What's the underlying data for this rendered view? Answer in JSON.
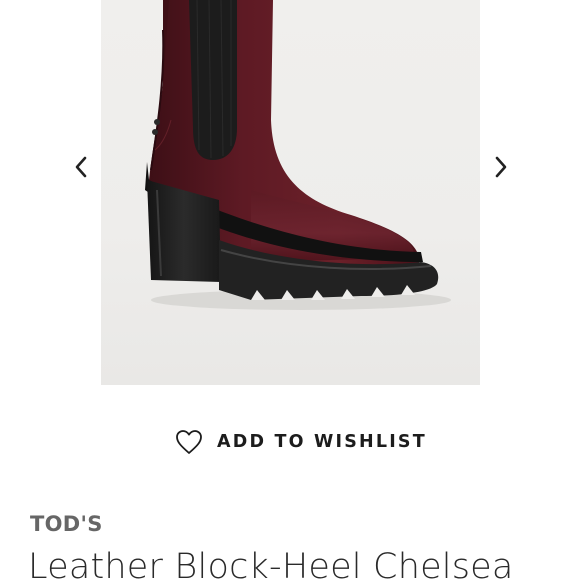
{
  "gallery": {
    "image_alt": "Tod's burgundy leather block-heel Chelsea boot",
    "prev_icon": "chevron-left-icon",
    "next_icon": "chevron-right-icon"
  },
  "wishlist": {
    "label": "ADD TO WISHLIST",
    "icon": "heart-outline-icon"
  },
  "product": {
    "brand": "TOD'S",
    "title": "Leather Block-Heel Chelsea"
  },
  "colors": {
    "leather": "#5a1a22",
    "elastic": "#1c1c1c",
    "sole": "#232323",
    "background": "#eeedeb"
  }
}
